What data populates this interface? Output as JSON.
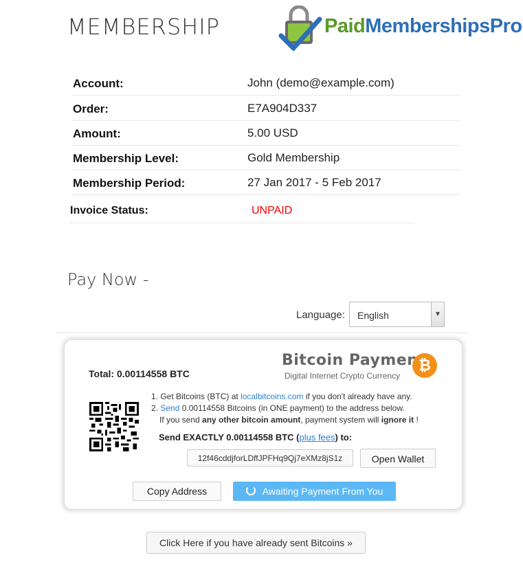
{
  "header": {
    "title": "MEMBERSHIP",
    "logo_part1": "Paid",
    "logo_part2": "MembershipsPro"
  },
  "invoice": {
    "rows": [
      {
        "label": "Account:",
        "value": "John (demo@example.com)"
      },
      {
        "label": "Order:",
        "value": "E7A904D337"
      },
      {
        "label": "Amount:",
        "value": "5.00 USD"
      },
      {
        "label": "Membership Level:",
        "value": "Gold Membership"
      },
      {
        "label": "Membership Period:",
        "value": "27 Jan 2017 - 5 Feb 2017"
      }
    ],
    "status_label": "Invoice Status:",
    "status_value": "UNPAID",
    "status_color": "#e00000"
  },
  "pay": {
    "heading": "Pay Now -",
    "language_label": "Language:",
    "language_value": "English"
  },
  "payment_box": {
    "total_label": "Total:",
    "total_amount": "0.00114558",
    "total_unit": "BTC",
    "logo_title": "Bitcoin Payment",
    "logo_subtitle": "Digital Internet Crypto Currency",
    "logo_coin_symbol": "₿",
    "step1_prefix": "1. Get Bitcoins (BTC) at ",
    "step1_link": "localbitcoins.com",
    "step1_suffix": " if you don't already have any.",
    "step2_prefix": "2. ",
    "step2_link": "Send",
    "step2_suffix": " 0.00114558 Bitcoins (in ONE payment) to the address below.",
    "step3_prefix": "If you send ",
    "step3_bold": "any other bitcoin amount",
    "step3_mid": ", payment system will ",
    "step3_bold2": "ignore it",
    "step3_suffix": " !",
    "exact_prefix": "Send EXACTLY 0.00114558 BTC (",
    "exact_link": "plus fees",
    "exact_suffix": ") to:",
    "address": "12f46cddjforLDffJPFHq9Qj7eXMz8jS1z",
    "open_wallet": "Open Wallet",
    "copy_address": "Copy Address",
    "awaiting": "Awaiting Payment From You",
    "accent_color": "#5bb8f5",
    "coin_color": "#f39019"
  },
  "footer": {
    "sent_button": "Click Here if you have already sent Bitcoins »"
  }
}
